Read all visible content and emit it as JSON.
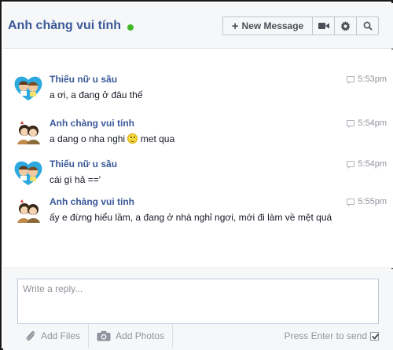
{
  "header": {
    "title": "Anh chàng vui tính",
    "status_color": "#42b72a",
    "new_message_label": "New Message",
    "icons": [
      "plus-icon",
      "video-icon",
      "gear-icon",
      "search-icon"
    ]
  },
  "messages": [
    {
      "sender": "Thiếu nữ u sầu",
      "time": "5:53pm",
      "text": "a ơi, a đang ở đâu thế",
      "avatar": "heart-couple-avatar"
    },
    {
      "sender": "Anh chàng vui tính",
      "time": "5:54pm",
      "text_before": "a dang o nha nghi",
      "emoji": "smiley-icon",
      "text_after": "met qua",
      "avatar": "cute-couple-avatar"
    },
    {
      "sender": "Thiếu nữ u sầu",
      "time": "5:54pm",
      "text": "cái gì hả =='",
      "avatar": "heart-couple-avatar"
    },
    {
      "sender": "Anh chàng vui tính",
      "time": "5:55pm",
      "text": "ấy e đừng hiểu lầm, a đang ở nhà nghỉ ngơi, mới đi làm về mệt quá",
      "avatar": "cute-couple-avatar"
    }
  ],
  "composer": {
    "placeholder": "Write a reply...",
    "add_files_label": "Add Files",
    "add_photos_label": "Add Photos",
    "press_enter_label": "Press Enter to send",
    "press_enter_checked": true
  },
  "colors": {
    "link_blue": "#3b5998",
    "header_bg": "#f6f7f9",
    "muted_text": "#90949c"
  }
}
